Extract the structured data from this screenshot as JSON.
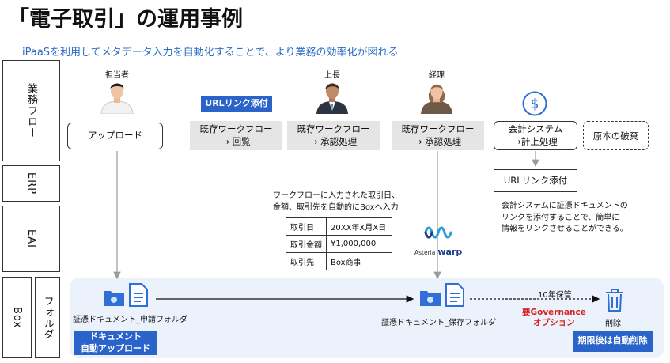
{
  "title": "「電子取引」の運用事例",
  "subtitle": "iPaaSを利用してメタデータ入力を自動化することで、より業務の効率化が図れる",
  "lanes": {
    "business_flow": "業務フロー",
    "erp": "ERP",
    "eai": "EAI",
    "box": "Box",
    "folder": "フォルダ"
  },
  "people": {
    "owner": "担当者",
    "boss": "上長",
    "accounting": "経理"
  },
  "flow": {
    "upload": "アップロード",
    "url_link_tag": "URLリンク添付",
    "existing_wf_view_1": "既存ワークフロー",
    "existing_wf_view_2": "→ 回覧",
    "existing_wf_approve_1": "既存ワークフロー",
    "existing_wf_approve_2": "→ 承認処理",
    "existing_wf_acc_1": "既存ワークフロー",
    "existing_wf_acc_2": "→ 承認処理",
    "accounting_system_1": "会計システム",
    "accounting_system_2": "→計上処理",
    "destroy_original": "原本の破棄",
    "erp_url_link": "URLリンク添付"
  },
  "notes": {
    "workflow_input_1": "ワークフローに入力された取引日、",
    "workflow_input_2": "金額、取引先を自動的にBoxへ入力",
    "erp_note_1": "会計システムに証憑ドキュメントの",
    "erp_note_2": "リンクを添付することで、簡単に",
    "erp_note_3": "情報をリンクさせることができる。"
  },
  "metadata_table": [
    {
      "key": "取引日",
      "value": "20XX年X月X日"
    },
    {
      "key": "取引金額",
      "value": "¥1,000,000"
    },
    {
      "key": "取引先",
      "value": "Box商事"
    }
  ],
  "eai_logo": {
    "brand": "Asteria",
    "product": "warp"
  },
  "box_lane": {
    "apply_folder": "証憑ドキュメント_申請フォルダ",
    "store_folder": "証憑ドキュメント_保存フォルダ",
    "retention": "10年保管",
    "governance_1": "要Governance",
    "governance_2": "オプション",
    "delete": "削除",
    "auto_upload_1": "ドキュメント",
    "auto_upload_2": "自動アップロード",
    "auto_delete": "期限後は自動削除"
  },
  "colors": {
    "accent_blue": "#2a63c9",
    "subtitle_blue": "#2b6cc4",
    "box_area": "#ebf2fb",
    "governance_red": "#d62020",
    "icon_blue": "#2f6fd6"
  }
}
